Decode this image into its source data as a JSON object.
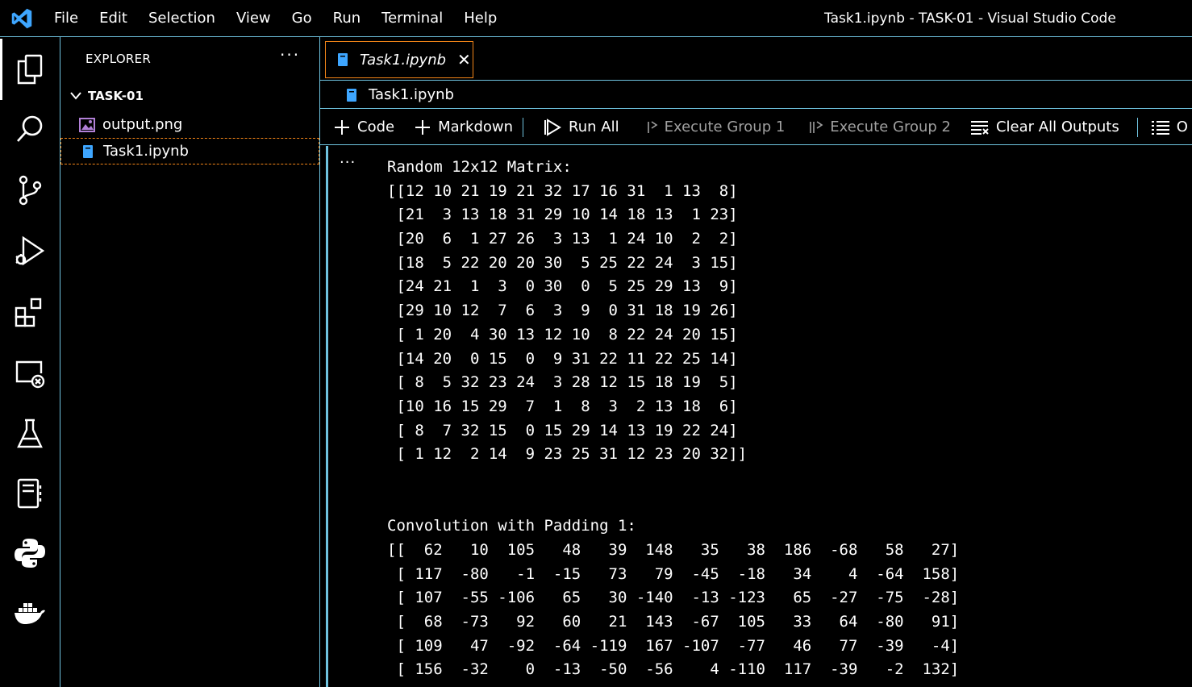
{
  "window": {
    "title": "Task1.ipynb - TASK-01 - Visual Studio Code"
  },
  "menu": [
    "File",
    "Edit",
    "Selection",
    "View",
    "Go",
    "Run",
    "Terminal",
    "Help"
  ],
  "activity_bar": [
    "explorer-icon",
    "search-icon",
    "source-control-icon",
    "run-debug-icon",
    "extensions-icon",
    "remote-explorer-icon",
    "testing-icon",
    "notebook-icon",
    "python-icon",
    "docker-icon"
  ],
  "sidebar": {
    "header": "EXPLORER",
    "more": "···",
    "folder": "TASK-01",
    "files": [
      {
        "name": "output.png",
        "icon": "image-icon"
      },
      {
        "name": "Task1.ipynb",
        "icon": "notebook-file-icon"
      }
    ]
  },
  "editor": {
    "tab_label": "Task1.ipynb",
    "tab_close": "✕",
    "breadcrumb": "Task1.ipynb",
    "toolbar": {
      "code": "Code",
      "markdown": "Markdown",
      "run_all": "Run All",
      "execute_group_1": "Execute Group 1",
      "execute_group_2": "Execute Group 2",
      "clear_all_outputs": "Clear All Outputs",
      "outline": "O"
    },
    "cell_ellipsis": "···",
    "output_lines": [
      "Random 12x12 Matrix:",
      "[[12 10 21 19 21 32 17 16 31  1 13  8]",
      " [21  3 13 18 31 29 10 14 18 13  1 23]",
      " [20  6  1 27 26  3 13  1 24 10  2  2]",
      " [18  5 22 20 20 30  5 25 22 24  3 15]",
      " [24 21  1  3  0 30  0  5 25 29 13  9]",
      " [29 10 12  7  6  3  9  0 31 18 19 26]",
      " [ 1 20  4 30 13 12 10  8 22 24 20 15]",
      " [14 20  0 15  0  9 31 22 11 22 25 14]",
      " [ 8  5 32 23 24  3 28 12 15 18 19  5]",
      " [10 16 15 29  7  1  8  3  2 13 18  6]",
      " [ 8  7 32 15  0 15 29 14 13 19 22 24]",
      " [ 1 12  2 14  9 23 25 31 12 23 20 32]]",
      "",
      "",
      "Convolution with Padding 1:",
      "[[  62   10  105   48   39  148   35   38  186  -68   58   27]",
      " [ 117  -80   -1  -15   73   79  -45  -18   34    4  -64  158]",
      " [ 107  -55 -106   65   30 -140  -13 -123   65  -27  -75  -28]",
      " [  68  -73   92   60   21  143  -67  105   33   64  -80   91]",
      " [ 109   47  -92  -64 -119  167 -107  -77   46   77  -39   -4]",
      " [ 156  -32    0  -13  -50  -56    4 -110  117  -39   -2  132]"
    ]
  },
  "colors": {
    "contrast_border": "#6fc3df",
    "active_border": "#f38518",
    "vscode_blue": "#3ea6ff",
    "disabled_text": "#a0a0a0"
  }
}
